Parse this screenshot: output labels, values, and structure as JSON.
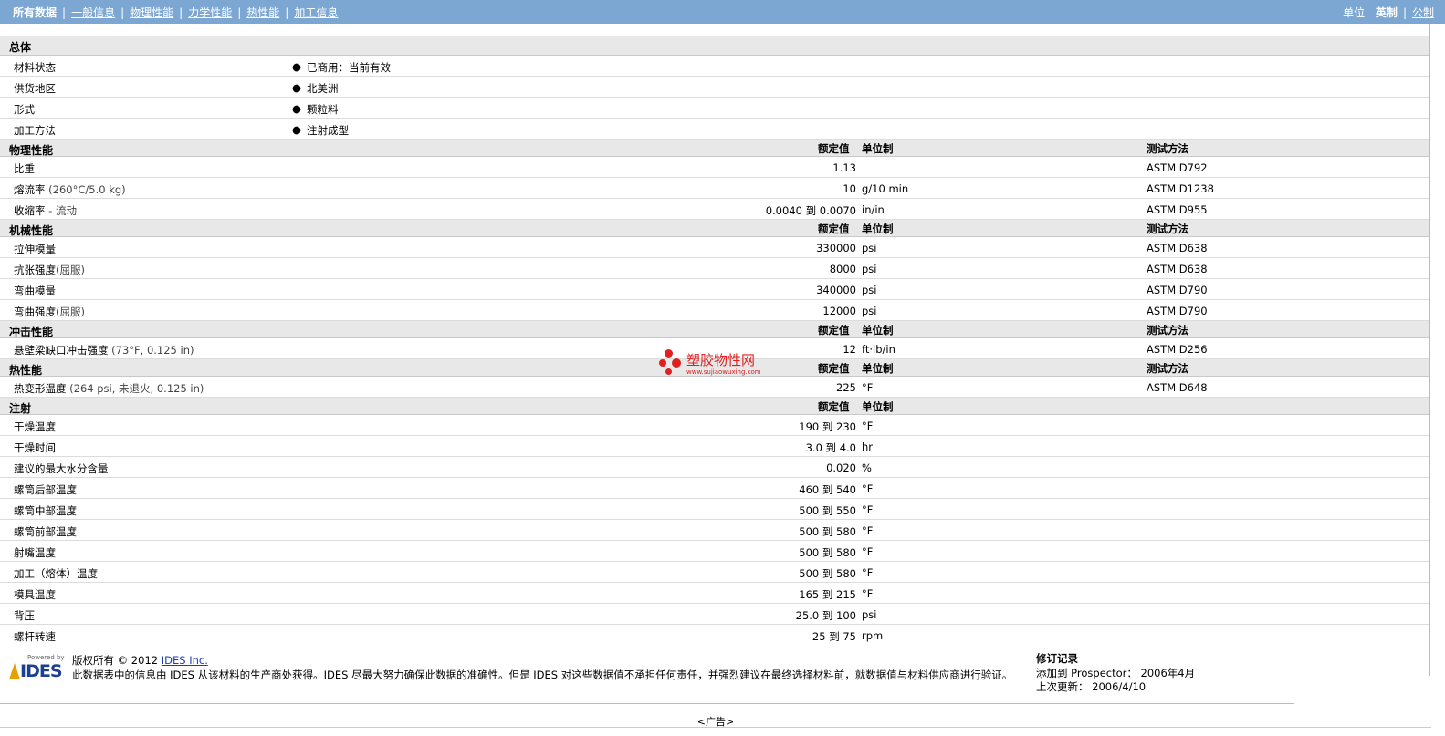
{
  "nav": {
    "all_data": "所有数据",
    "links": [
      "一般信息",
      "物理性能",
      "力学性能",
      "热性能",
      "加工信息"
    ],
    "unit_label": "单位",
    "english": "英制",
    "metric": "公制"
  },
  "col_headers": {
    "nominal": "额定值",
    "unit": "单位制",
    "test": "测试方法"
  },
  "general": {
    "title": "总体",
    "rows": [
      {
        "name": "材料状态",
        "value": "已商用：当前有效"
      },
      {
        "name": "供货地区",
        "value": "北美洲"
      },
      {
        "name": "形式",
        "value": "颗粒料"
      },
      {
        "name": "加工方法",
        "value": "注射成型"
      }
    ]
  },
  "physical": {
    "title": "物理性能",
    "rows": [
      {
        "name": "比重",
        "cond": "",
        "value": "1.13",
        "unit": "",
        "test": "ASTM D792"
      },
      {
        "name": "熔流率",
        "cond": "(260°C/5.0 kg)",
        "value": "10",
        "unit": "g/10 min",
        "test": "ASTM D1238"
      },
      {
        "name": "收缩率",
        "cond": "- 流动",
        "value": "0.0040 到 0.0070",
        "unit": "in/in",
        "test": "ASTM D955"
      }
    ]
  },
  "mechanical": {
    "title": "机械性能",
    "rows": [
      {
        "name": "拉伸模量",
        "cond": "",
        "value": "330000",
        "unit": "psi",
        "test": "ASTM D638"
      },
      {
        "name": "抗张强度",
        "cond": "(屈服)",
        "value": "8000",
        "unit": "psi",
        "test": "ASTM D638"
      },
      {
        "name": "弯曲模量",
        "cond": "",
        "value": "340000",
        "unit": "psi",
        "test": "ASTM D790"
      },
      {
        "name": "弯曲强度",
        "cond": "(屈服)",
        "value": "12000",
        "unit": "psi",
        "test": "ASTM D790"
      }
    ]
  },
  "impact": {
    "title": "冲击性能",
    "rows": [
      {
        "name": "悬壁梁缺口冲击强度",
        "cond": "(73°F, 0.125 in)",
        "value": "12",
        "unit": "ft·lb/in",
        "test": "ASTM D256"
      }
    ]
  },
  "thermal": {
    "title": "热性能",
    "rows": [
      {
        "name": "热变形温度",
        "cond": "(264 psi, 未退火, 0.125 in)",
        "value": "225",
        "unit": "°F",
        "test": "ASTM D648"
      }
    ]
  },
  "injection": {
    "title": "注射",
    "rows": [
      {
        "name": "干燥温度",
        "value": "190 到  230",
        "unit": "°F"
      },
      {
        "name": "干燥时间",
        "value": "3.0 到  4.0",
        "unit": "hr"
      },
      {
        "name": "建议的最大水分含量",
        "value": "0.020",
        "unit": "%"
      },
      {
        "name": "螺筒后部温度",
        "value": "460 到  540",
        "unit": "°F"
      },
      {
        "name": "螺筒中部温度",
        "value": "500 到  550",
        "unit": "°F"
      },
      {
        "name": "螺筒前部温度",
        "value": "500 到  580",
        "unit": "°F"
      },
      {
        "name": "射嘴温度",
        "value": "500 到  580",
        "unit": "°F"
      },
      {
        "name": "加工（熔体）温度",
        "value": "500 到  580",
        "unit": "°F"
      },
      {
        "name": "模具温度",
        "value": "165 到  215",
        "unit": "°F"
      },
      {
        "name": "背压",
        "value": "25.0 到  100",
        "unit": "psi"
      },
      {
        "name": "螺杆转速",
        "value": "25 到  75",
        "unit": "rpm"
      }
    ]
  },
  "watermark": {
    "title": "塑胶物性网",
    "url": "www.sujiaowuxing.com"
  },
  "footer": {
    "logo_powered": "Powered by",
    "logo_text": "IDES",
    "copyright": "版权所有 © 2012 ",
    "company_link": "IDES Inc.",
    "disclaimer": "此数据表中的信息由 IDES 从该材料的生产商处获得。IDES 尽最大努力确保此数据的准确性。但是 IDES 对这些数据值不承担任何责任，并强烈建议在最终选择材料前，就数据值与材料供应商进行验证。",
    "rev_title": "修订记录",
    "added": "添加到 Prospector：  2006年4月",
    "updated": "上次更新：  2006/4/10",
    "ad": "<广告>"
  },
  "colors": {
    "nav_bg": "#7da7d3",
    "section_bg": "#e8e8e8",
    "watermark": "#e02020",
    "link": "#1a3fb0"
  }
}
